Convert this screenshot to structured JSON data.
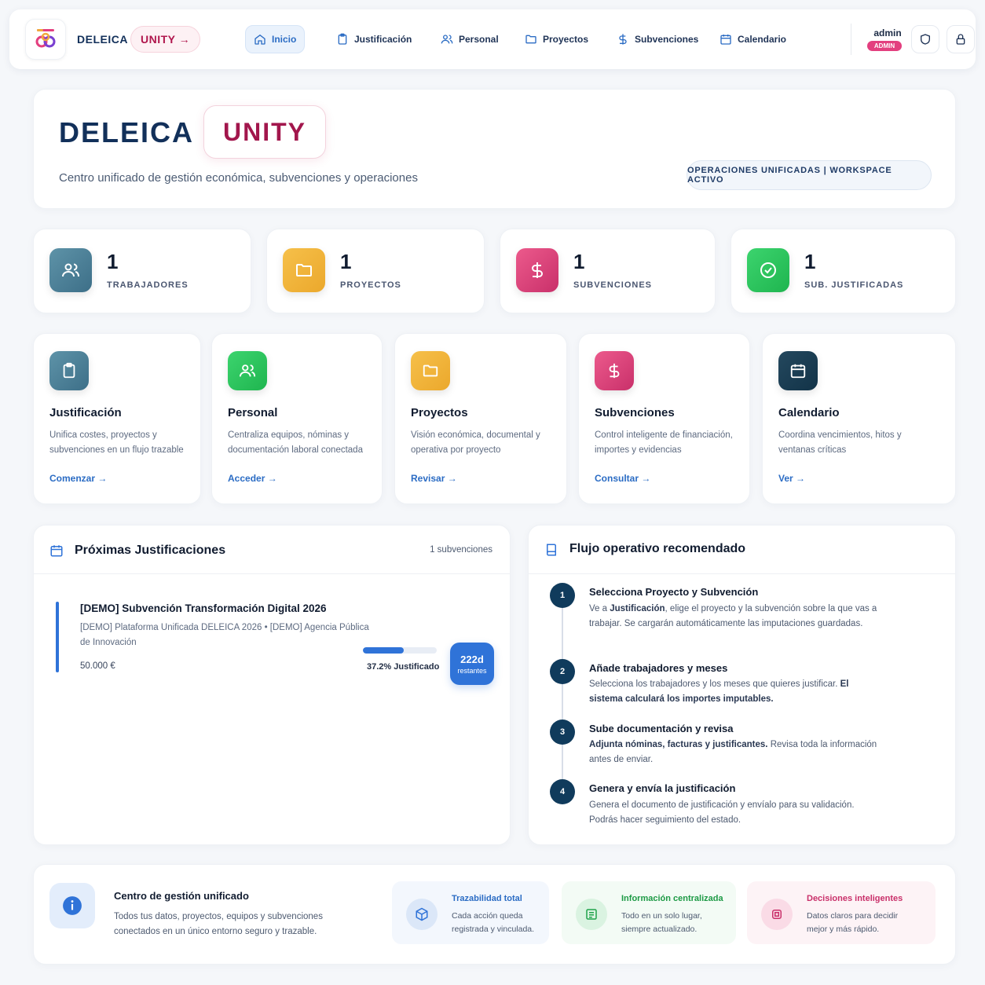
{
  "colors": {
    "primary_blue": "#2f73d8",
    "navy": "#12305a",
    "brand_pink": "#b0164d",
    "admin_pink": "#e33f7f"
  },
  "nav": {
    "brand": "DELEICA",
    "unity": "UNITY →",
    "items": [
      {
        "label": "Inicio",
        "icon": "home-icon",
        "active": true
      },
      {
        "label": "Justificación",
        "icon": "clipboard-icon"
      },
      {
        "label": "Personal",
        "icon": "users-icon"
      },
      {
        "label": "Proyectos",
        "icon": "folder-icon"
      },
      {
        "label": "Subvenciones",
        "icon": "dollar-icon"
      },
      {
        "label": "Calendario",
        "icon": "calendar-icon"
      }
    ],
    "user": "admin",
    "role": "ADMIN"
  },
  "hero": {
    "title": "DELEICA",
    "unity": "UNITY",
    "subtitle": "Centro unificado de gestión económica, subvenciones y operaciones",
    "status_pill": "OPERACIONES UNIFICADAS | WORKSPACE ACTIVO"
  },
  "stats": [
    {
      "value": "1",
      "label": "TRABAJADORES",
      "icon": "users-icon"
    },
    {
      "value": "1",
      "label": "PROYECTOS",
      "icon": "folder-icon"
    },
    {
      "value": "1",
      "label": "SUBVENCIONES",
      "icon": "dollar-icon"
    },
    {
      "value": "1",
      "label": "SUB. JUSTIFICADAS",
      "icon": "check-circle-icon"
    }
  ],
  "modules": [
    {
      "title": "Justificación",
      "desc": "Unifica costes, proyectos y subvenciones en un flujo trazable",
      "link": "Comenzar →"
    },
    {
      "title": "Personal",
      "desc": "Centraliza equipos, nóminas y documentación laboral conectada",
      "link": "Acceder →"
    },
    {
      "title": "Proyectos",
      "desc": "Visión económica, documental y operativa por proyecto",
      "link": "Revisar →"
    },
    {
      "title": "Subvenciones",
      "desc": "Control inteligente de financiación, importes y evidencias",
      "link": "Consultar →"
    },
    {
      "title": "Calendario",
      "desc": "Coordina vencimientos, hitos y ventanas críticas",
      "link": "Ver →"
    }
  ],
  "upcoming": {
    "title": "Próximas Justificaciones",
    "count": "1 subvenciones",
    "item": {
      "title": "[DEMO] Subvención Transformación Digital 2026",
      "meta": "[DEMO] Plataforma Unificada DELEICA 2026  •  [DEMO] Agencia Pública de Innovación",
      "amount": "50.000 €",
      "progress": 37.2,
      "progress_label": "37.2% Justificado",
      "days": "222d",
      "days_label": "restantes"
    }
  },
  "flow": {
    "title": "Flujo operativo recomendado",
    "steps": [
      {
        "num": "1",
        "title": "Selecciona Proyecto y Subvención",
        "desc_pre": "Ve a ",
        "desc_bold": "Justificación",
        "desc_post": ", elige el proyecto y la subvención sobre la que vas a trabajar. Se cargarán automáticamente las imputaciones guardadas."
      },
      {
        "num": "2",
        "title": "Añade trabajadores y meses",
        "desc_pre": "Selecciona los trabajadores y los meses que quieres justificar. ",
        "desc_bold": "El sistema calculará los importes imputables.",
        "desc_post": ""
      },
      {
        "num": "3",
        "title": "Sube documentación y revisa",
        "desc_pre": "",
        "desc_bold": "Adjunta nóminas, facturas y justificantes.",
        "desc_post": " Revisa toda la información antes de enviar."
      },
      {
        "num": "4",
        "title": "Genera y envía la justificación",
        "desc_pre": "Genera el documento de justificación y envíalo para su validación. Podrás hacer seguimiento del estado.",
        "desc_bold": "",
        "desc_post": ""
      }
    ]
  },
  "footer": {
    "title": "Centro de gestión unificado",
    "desc": "Todos tus datos, proyectos, equipos y subvenciones conectados en un único entorno seguro y trazable.",
    "features": [
      {
        "title": "Trazabilidad total",
        "desc": "Cada acción queda registrada y vinculada."
      },
      {
        "title": "Información centralizada",
        "desc": "Todo en un solo lugar, siempre actualizado."
      },
      {
        "title": "Decisiones inteligentes",
        "desc": "Datos claros para decidir mejor y más rápido."
      }
    ]
  }
}
